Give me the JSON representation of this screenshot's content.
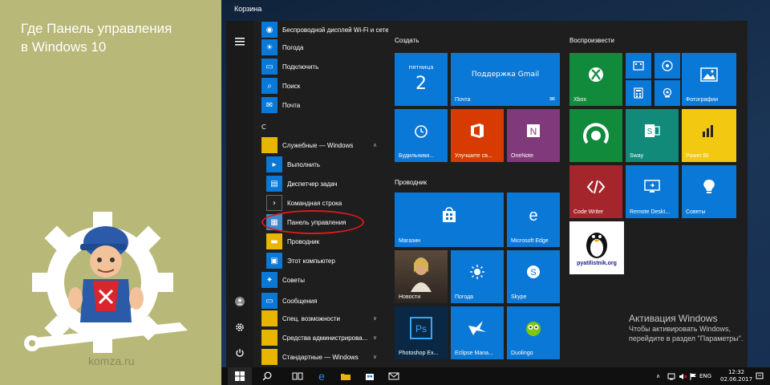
{
  "article": {
    "headline_line1": "Где Панель управления",
    "headline_line2": "в Windows 10",
    "site": "komza.ru"
  },
  "desktop": {
    "recycle_bin_label": "Корзина"
  },
  "app_list": {
    "items": [
      {
        "label": "Беспроводной дисплей Wi-Fi и сетевых",
        "icon": "wireless-icon"
      },
      {
        "label": "Погода",
        "icon": "weather-icon"
      },
      {
        "label": "Подключить",
        "icon": "connect-icon"
      },
      {
        "label": "Поиск",
        "icon": "search-icon"
      },
      {
        "label": "Почта",
        "icon": "mail-icon"
      }
    ],
    "section_c": "C",
    "folder_tools": "Служебные — Windows",
    "tools": [
      {
        "label": "Выполнить",
        "icon": "run-icon"
      },
      {
        "label": "Диспетчер задач",
        "icon": "task-manager-icon"
      },
      {
        "label": "Командная строка",
        "icon": "cmd-icon"
      },
      {
        "label": "Панель управления",
        "icon": "control-panel-icon"
      },
      {
        "label": "Проводник",
        "icon": "explorer-icon"
      },
      {
        "label": "Этот компьютер",
        "icon": "computer-icon"
      }
    ],
    "after": [
      {
        "label": "Советы",
        "icon": "tips-icon"
      },
      {
        "label": "Сообщения",
        "icon": "messages-icon"
      }
    ],
    "folders": [
      {
        "label": "Спец. возможности"
      },
      {
        "label": "Средства администрирова..."
      },
      {
        "label": "Стандартные — Windows"
      }
    ]
  },
  "groups": {
    "create": "Создать",
    "explorer": "Проводник",
    "play": "Воспроизвести"
  },
  "tiles": {
    "calendar_day": "пятница",
    "calendar_date": "2",
    "mail_title": "Поддержка Gmail",
    "mail": "Почта",
    "alarms": "Будильники...",
    "office": "Улучшите св...",
    "onenote": "OneNote",
    "store": "Магазин",
    "edge": "Microsoft Edge",
    "news": "Новости",
    "weather": "Погода",
    "skype": "Skype",
    "photoshop": "Photoshop Ex...",
    "eclipse": "Eclipse Mana...",
    "duolingo": "Duolingo",
    "xbox": "Xbox",
    "photos": "Фотографии",
    "sway": "Sway",
    "powerbi": "Power BI",
    "codewriter": "Code Writer",
    "remote": "Remote Deskt...",
    "tips": "Советы",
    "pyatilistnik": "pyatilistnik.org"
  },
  "activation": {
    "title": "Активация Windows",
    "line1": "Чтобы активировать Windows,",
    "line2": "перейдите в раздел \"Параметры\"."
  },
  "taskbar": {
    "lang": "ENG",
    "time": "12:32",
    "date": "02.06.2017"
  },
  "colors": {
    "tile_blue": "#0a78d7",
    "tile_green": "#118a3c",
    "office_orange": "#d83b01",
    "onenote_purple": "#80397b",
    "powerbi_yellow": "#f2c811",
    "codewriter_red": "#a4262c",
    "annotation_red": "#d81a1a"
  }
}
